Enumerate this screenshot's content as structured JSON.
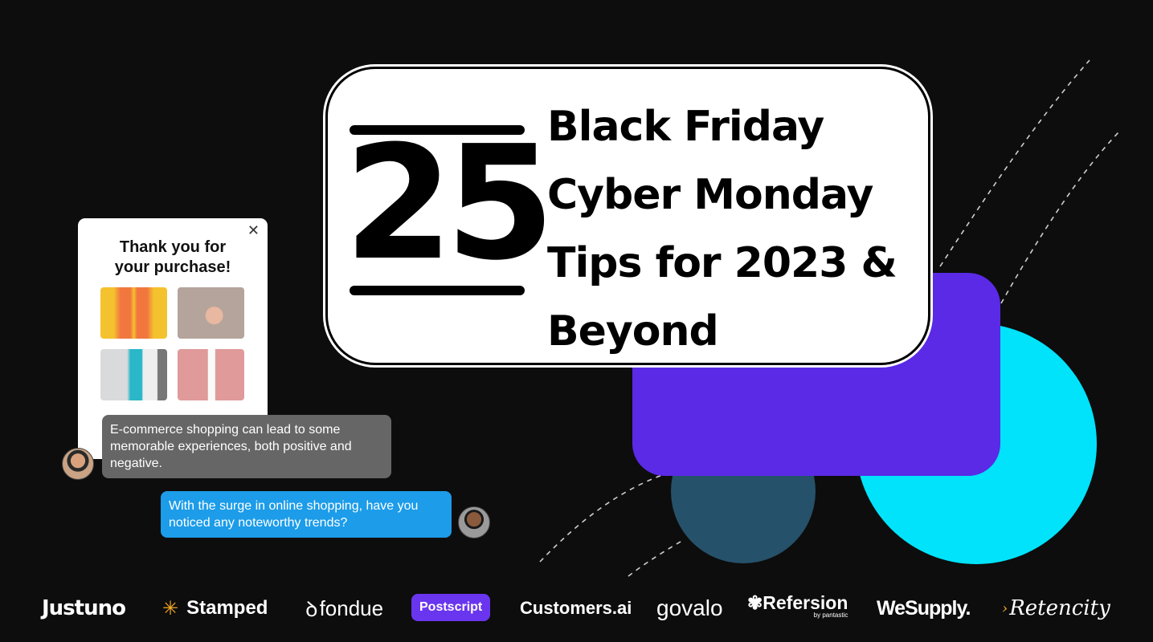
{
  "colors": {
    "background": "#0d0d0d",
    "purple": "#5a2ae6",
    "cyan": "#00e3fb",
    "teal": "#26516a",
    "chat_gray": "#666666",
    "chat_blue": "#1c9ce9"
  },
  "hero": {
    "number": "25",
    "title_lines": [
      "Black Friday",
      "Cyber Monday",
      "Tips for 2023 &",
      "Beyond"
    ]
  },
  "popup": {
    "title_line1": "Thank you for",
    "title_line2": "your purchase!",
    "close_icon": "close-icon"
  },
  "chat": {
    "message1": "E-commerce shopping can lead to some memorable experiences, both positive and negative.",
    "message2": "With the surge in online shopping, have you noticed any noteworthy trends?"
  },
  "logos": [
    "Justuno",
    "Stamped",
    "fondue",
    "Postscript",
    "Customers.ai",
    "govalo",
    "Refersion",
    "by pantastic",
    "WeSupply.",
    "Retencity"
  ]
}
